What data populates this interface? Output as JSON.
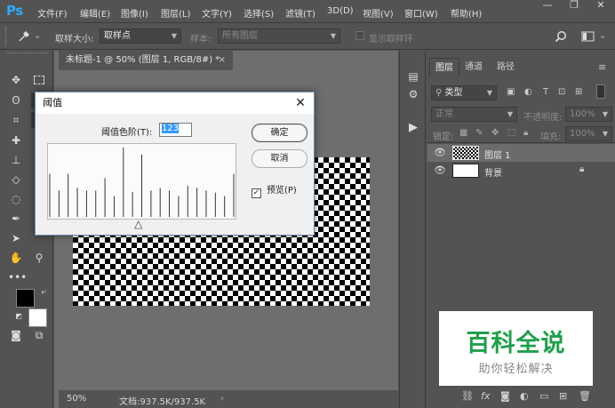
{
  "app": {
    "logo": "Ps"
  },
  "menu": [
    "文件(F)",
    "编辑(E)",
    "图像(I)",
    "图层(L)",
    "文字(Y)",
    "选择(S)",
    "滤镜(T)",
    "3D(D)",
    "视图(V)",
    "窗口(W)",
    "帮助(H)"
  ],
  "window_controls": {
    "minimize": "—",
    "restore": "❐",
    "close": "✕"
  },
  "options": {
    "sample_size_label": "取样大小:",
    "sample_size_value": "取样点",
    "sample_label": "样本:",
    "sample_value": "所有图层",
    "show_ring_label": "显示取样环"
  },
  "document": {
    "tab_title": "未标题-1 @ 50% (图层 1, RGB/8#) *",
    "tab_close": "×",
    "zoom": "50%",
    "doc_info": "文档:937.5K/937.5K"
  },
  "layers_panel": {
    "tabs": [
      "图层",
      "通道",
      "路径"
    ],
    "filter_kind": "类型",
    "blend_mode": "正常",
    "opacity_label": "不透明度:",
    "opacity_value": "100%",
    "lock_label": "锁定:",
    "fill_label": "填充:",
    "fill_value": "100%",
    "layers": [
      {
        "name": "图层 1",
        "visible": true,
        "selected": true
      },
      {
        "name": "背景",
        "visible": true,
        "locked": true
      }
    ]
  },
  "dialog": {
    "title": "阈值",
    "close": "✕",
    "threshold_label": "阈值色阶(T):",
    "threshold_value": "123",
    "ok_label": "确定",
    "cancel_label": "取消",
    "preview_label": "预览(P)",
    "preview_checked": true,
    "histogram_bars": [
      0.62,
      0.38,
      0.62,
      0.42,
      0.38,
      0.38,
      0.56,
      0.3,
      1.0,
      0.36,
      0.9,
      0.38,
      0.42,
      0.38,
      0.3,
      0.45,
      0.42,
      0.38,
      0.35,
      0.3,
      0.62
    ],
    "slider_value": 123
  },
  "watermark": {
    "title": "百科全说",
    "subtitle": "助你轻松解决"
  }
}
